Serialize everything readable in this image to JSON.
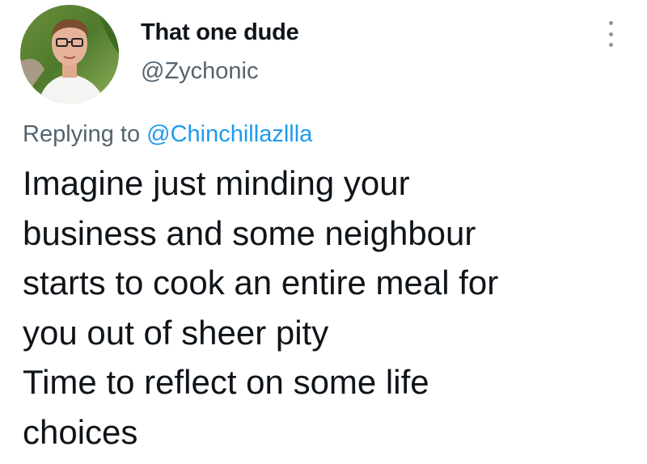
{
  "author": {
    "display_name": "That one dude",
    "handle": "@Zychonic"
  },
  "reply": {
    "prefix": "Replying to ",
    "mention": "@Chinchillazllla"
  },
  "tweet_lines": [
    "Imagine just minding your",
    "business and some neighbour",
    "starts to cook an entire meal for",
    "you out of sheer pity",
    "Time to reflect on some life",
    "choices"
  ],
  "icons": {
    "avatar": "profile-photo",
    "menu": "more-options-icon"
  },
  "colors": {
    "text": "#0f1419",
    "secondary": "#536471",
    "link": "#1d9bf0"
  }
}
